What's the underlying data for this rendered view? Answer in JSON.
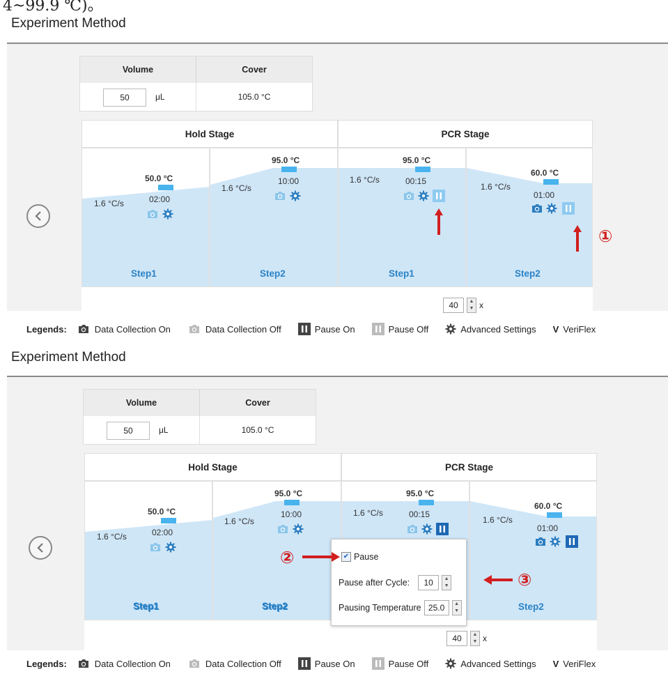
{
  "cropped_text": "4~99.9 ℃)。",
  "panels": [
    {
      "title": "Experiment Method",
      "volume_header": "Volume",
      "cover_header": "Cover",
      "volume_value": "50",
      "volume_unit": "μL",
      "cover_value": "105.0 °C",
      "stages": [
        {
          "name": "Hold Stage"
        },
        {
          "name": "PCR Stage"
        }
      ],
      "steps": [
        {
          "label": "Step1",
          "temp": "50.0 °C",
          "time": "02:00",
          "rate": "1.6 °C/s"
        },
        {
          "label": "Step2",
          "temp": "95.0 °C",
          "time": "10:00",
          "rate": "1.6 °C/s"
        },
        {
          "label": "Step1",
          "temp": "95.0 °C",
          "time": "00:15",
          "rate": "1.6 °C/s"
        },
        {
          "label": "Step2",
          "temp": "60.0 °C",
          "time": "01:00",
          "rate": "1.6 °C/s"
        }
      ],
      "cycles_value": "40",
      "cycles_unit": "x"
    },
    {
      "title": "Experiment Method",
      "volume_header": "Volume",
      "cover_header": "Cover",
      "volume_value": "50",
      "volume_unit": "μL",
      "cover_value": "105.0 °C",
      "stages": [
        {
          "name": "Hold Stage"
        },
        {
          "name": "PCR Stage"
        }
      ],
      "steps": [
        {
          "label": "Step1",
          "temp": "50.0 °C",
          "time": "02:00",
          "rate": "1.6 °C/s"
        },
        {
          "label": "Step2",
          "temp": "95.0 °C",
          "time": "10:00",
          "rate": "1.6 °C/s"
        },
        {
          "label": "Step1",
          "temp": "95.0 °C",
          "time": "00:15",
          "rate": "1.6 °C/s"
        },
        {
          "label": "Step2",
          "temp": "60.0 °C",
          "time": "01:00",
          "rate": "1.6 °C/s"
        }
      ],
      "cycles_value": "40",
      "cycles_unit": "x",
      "popup": {
        "pause_label": "Pause",
        "pause_checked": true,
        "pause_after_label": "Pause after Cycle:",
        "pause_after_value": "10",
        "pausing_temp_label": "Pausing Temperature",
        "pausing_temp_value": "25.0"
      }
    }
  ],
  "legend": {
    "title": "Legends:",
    "items": [
      {
        "icon": "camera-on-icon",
        "label": "Data Collection On"
      },
      {
        "icon": "camera-off-icon",
        "label": "Data Collection Off"
      },
      {
        "icon": "pause-on-icon",
        "label": "Pause On"
      },
      {
        "icon": "pause-off-icon",
        "label": "Pause Off"
      },
      {
        "icon": "gear-icon",
        "label": "Advanced Settings"
      },
      {
        "icon": "v-glyph",
        "label": "VeriFlex",
        "glyph": "V"
      }
    ]
  },
  "annotations": {
    "marker_1": "①",
    "marker_2": "②",
    "marker_3": "③"
  },
  "colors": {
    "curve_fill": "#cfe6f7",
    "step_label": "#2a82c6",
    "icon_on": "#2b7dc0",
    "icon_off": "#8cc6ea",
    "pause_on": "#1f69b5",
    "pause_off": "#8fcaf0",
    "annotation": "#d21f1f"
  }
}
